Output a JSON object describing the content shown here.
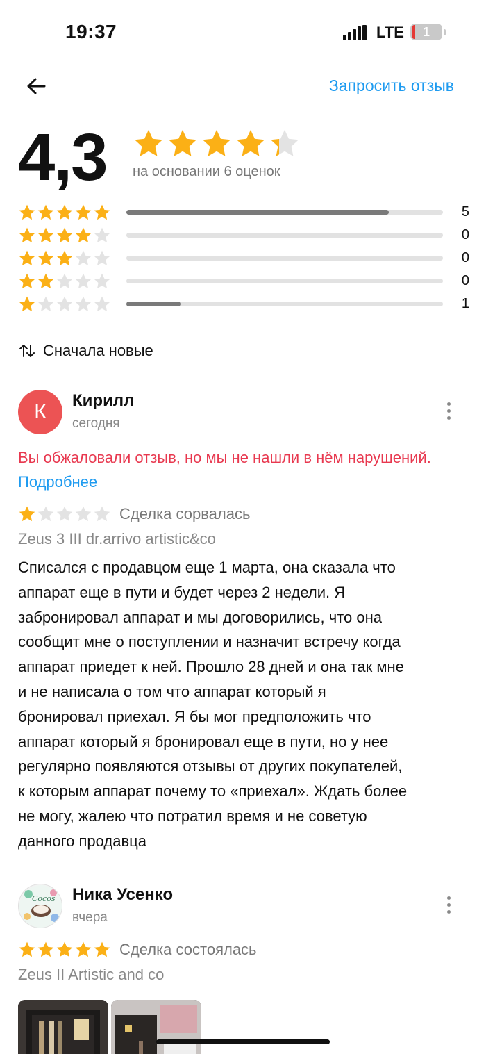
{
  "status_bar": {
    "time": "19:37",
    "network": "LTE",
    "battery": "1"
  },
  "header": {
    "request_review_label": "Запросить отзыв"
  },
  "summary": {
    "rating": "4,3",
    "rating_value": 4.3,
    "basis": "на основании 6 оценок",
    "distribution": [
      {
        "stars": 5,
        "count": "5",
        "fraction": 0.83
      },
      {
        "stars": 4,
        "count": "0",
        "fraction": 0
      },
      {
        "stars": 3,
        "count": "0",
        "fraction": 0
      },
      {
        "stars": 2,
        "count": "0",
        "fraction": 0
      },
      {
        "stars": 1,
        "count": "1",
        "fraction": 0.17
      }
    ]
  },
  "sort": {
    "label": "Сначала новые"
  },
  "reviews": [
    {
      "avatar_letter": "К",
      "author": "Кирилл",
      "date": "сегодня",
      "appeal_text": "Вы обжаловали отзыв, но мы не нашли в нём нарушений.",
      "appeal_link": "Подробнее",
      "stars": 1,
      "deal_status": "Сделка сорвалась",
      "product": "Zeus 3 III dr.arrivo artistic&co",
      "text_lines": [
        "Списался с продавцом еще 1 марта, она сказала что",
        "аппарат еще в пути и будет через 2 недели. Я",
        "забронировал аппарат и мы договорились, что она",
        "сообщит мне о поступлении и назначит встречу когда",
        "аппарат приедет к ней. Прошло 28 дней и она так  мне",
        "и не написала о том что аппарат который я",
        "бронировал приехал. Я бы мог предположить что",
        "аппарат который я бронировал еще в пути, но у нее",
        "регулярно появляются отзывы от других покупателей,",
        "к которым аппарат почему то «приехал». Ждать более",
        "не могу, жалею что потратил время и не советую",
        "данного продавца"
      ]
    },
    {
      "author": "Ника Усенко",
      "date": "вчера",
      "avatar_text": "Cocos",
      "stars": 5,
      "deal_status": "Сделка состоялась",
      "product": "Zeus II Artistic and co"
    }
  ],
  "colors": {
    "star": "#fbb016",
    "star_empty": "#e3e3e3",
    "link": "#1e9bf0",
    "warning": "#e8384f",
    "avatar_bg": "#ec5354"
  }
}
